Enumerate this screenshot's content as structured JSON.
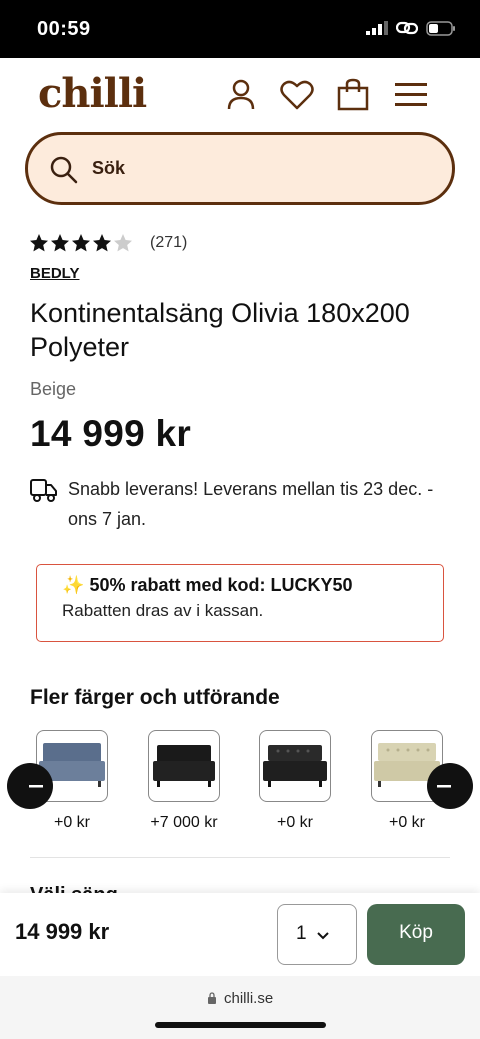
{
  "status_bar": {
    "time": "00:59"
  },
  "header": {
    "logo": "chilli"
  },
  "search": {
    "placeholder": "Sök"
  },
  "product": {
    "rating": 4.5,
    "rating_count": "(271)",
    "brand": "BEDLY",
    "title": "Kontinentalsäng Olivia 180x200 Polyeter",
    "color": "Beige",
    "price": "14 999 kr",
    "delivery": "Snabb leverans! Leverans mellan tis 23 dec. - ons 7 jan."
  },
  "promo": {
    "emoji": "✨",
    "headline": "50% rabatt med kod: LUCKY50",
    "subtext": "Rabatten dras av i kassan."
  },
  "variants": {
    "heading": "Fler färger och utförande",
    "items": [
      {
        "price": "+0 kr",
        "color": "#5a6e8c",
        "name": "blue-bed"
      },
      {
        "price": "+7 000 kr",
        "color": "#1a1a1a",
        "name": "black-bed"
      },
      {
        "price": "+0 kr",
        "color": "#2a2a2a",
        "name": "black-tufted-bed"
      },
      {
        "price": "+0 kr",
        "color": "#d8d3b3",
        "name": "beige-tufted-bed"
      }
    ]
  },
  "peek_text": "Välj säng ……",
  "buy_bar": {
    "price": "14 999 kr",
    "quantity": "1",
    "buy_label": "Köp"
  },
  "browser": {
    "url": "chilli.se"
  },
  "colors": {
    "brand_brown": "#5c2f0e",
    "search_bg": "#fdebdc",
    "promo_border": "#d9543f",
    "buy_green": "#486b50"
  }
}
